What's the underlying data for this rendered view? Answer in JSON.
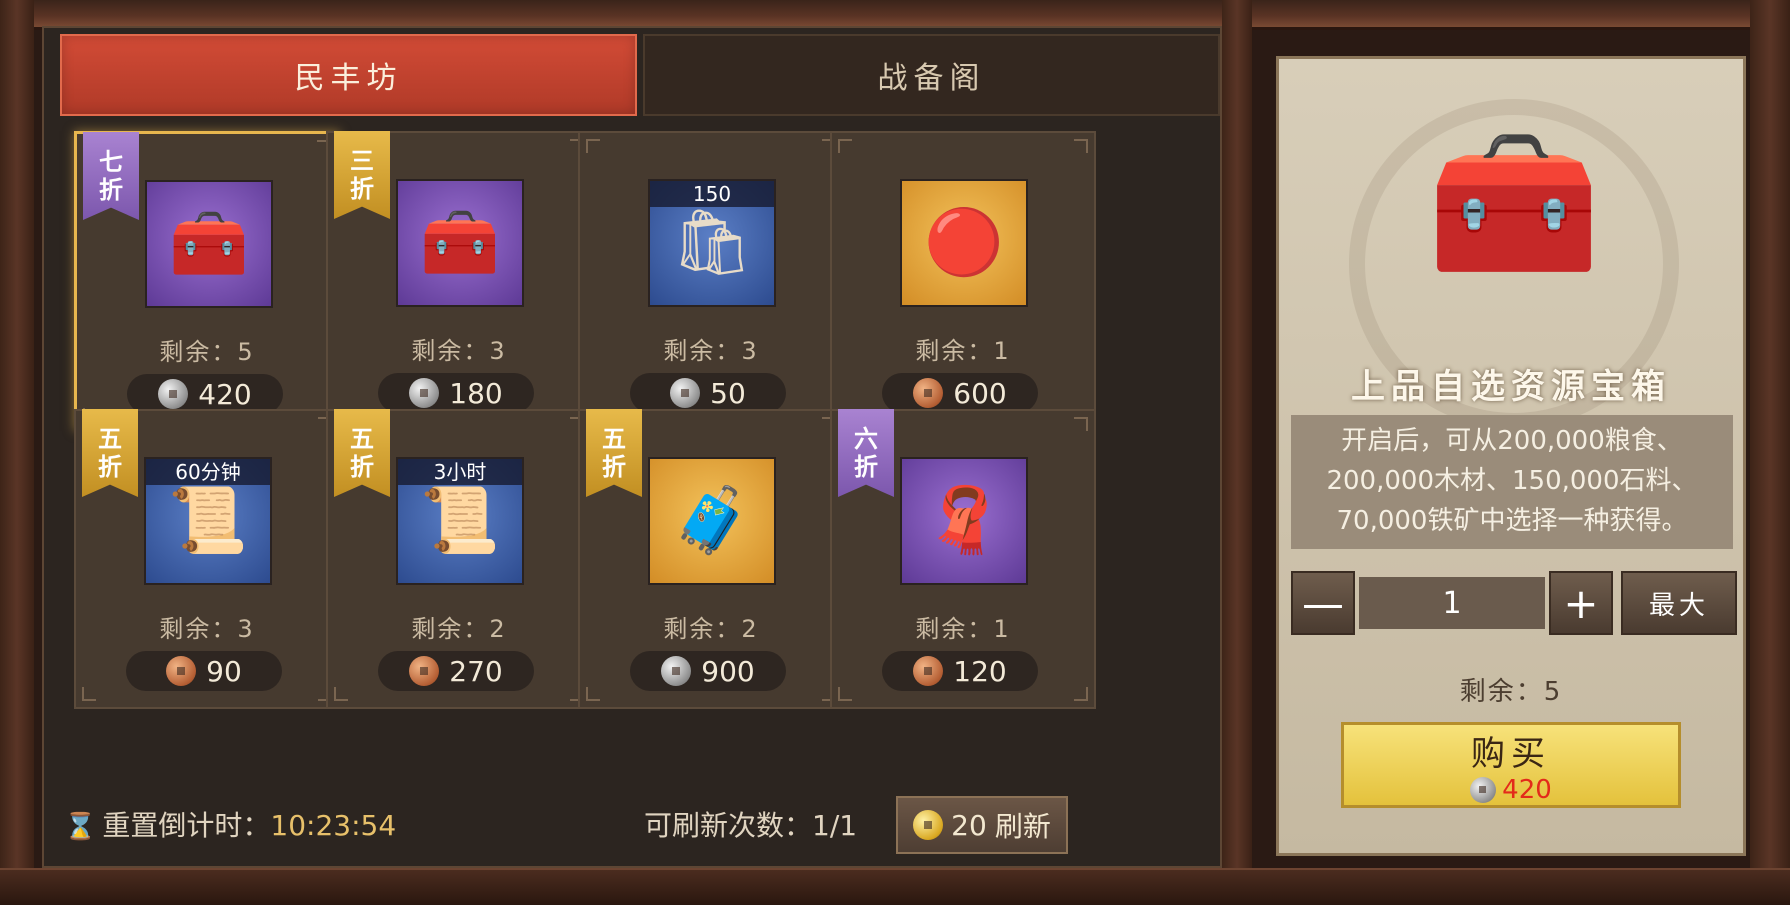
{
  "tabs": [
    {
      "label": "民丰坊",
      "active": true
    },
    {
      "label": "战备阁",
      "active": false
    }
  ],
  "items": [
    {
      "discount_line1": "七",
      "discount_line2": "折",
      "ribbon_color": "purple",
      "icon": "resource-chest-icon",
      "icon_bg": "purple",
      "tag": "",
      "remain": "剩余：5",
      "price": "420",
      "currency": "silver",
      "selected": true
    },
    {
      "discount_line1": "三",
      "discount_line2": "折",
      "ribbon_color": "gold",
      "icon": "resource-chest-icon",
      "icon_bg": "purple",
      "tag": "",
      "remain": "剩余：3",
      "price": "180",
      "currency": "silver",
      "selected": false
    },
    {
      "discount_line1": "",
      "discount_line2": "",
      "ribbon_color": "",
      "icon": "grain-sack-icon",
      "icon_bg": "blue",
      "tag": "150",
      "remain": "剩余：3",
      "price": "50",
      "currency": "silver",
      "selected": false
    },
    {
      "discount_line1": "",
      "discount_line2": "",
      "ribbon_color": "",
      "icon": "red-jade-icon",
      "icon_bg": "orange",
      "tag": "",
      "remain": "剩余：1",
      "price": "600",
      "currency": "copper",
      "selected": false
    },
    {
      "discount_line1": "五",
      "discount_line2": "折",
      "ribbon_color": "gold",
      "icon": "speedup-scroll-icon",
      "icon_bg": "blue",
      "tag": "60分钟",
      "remain": "剩余：3",
      "price": "90",
      "currency": "copper",
      "selected": false
    },
    {
      "discount_line1": "五",
      "discount_line2": "折",
      "ribbon_color": "gold",
      "icon": "speedup-scroll-icon",
      "icon_bg": "blue",
      "tag": "3小时",
      "remain": "剩余：2",
      "price": "270",
      "currency": "copper",
      "selected": false
    },
    {
      "discount_line1": "五",
      "discount_line2": "折",
      "ribbon_color": "gold",
      "icon": "wooden-chest-icon",
      "icon_bg": "orange",
      "tag": "",
      "remain": "剩余：2",
      "price": "900",
      "currency": "silver",
      "selected": false
    },
    {
      "discount_line1": "六",
      "discount_line2": "折",
      "ribbon_color": "purple",
      "icon": "purple-cloth-icon",
      "icon_bg": "purple",
      "tag": "",
      "remain": "剩余：1",
      "price": "120",
      "currency": "copper",
      "selected": false
    }
  ],
  "footer": {
    "reset_label": "重置倒计时：",
    "reset_time": "10:23:54",
    "refresh_count": "可刷新次数：1/1",
    "refresh_cost": "20",
    "refresh_label": "刷新"
  },
  "detail": {
    "title": "上品自选资源宝箱",
    "desc_line1": "开启后，可从200,000粮食、",
    "desc_line2": "200,000木材、150,000石料、",
    "desc_line3": "70,000铁矿中选择一种获得。",
    "minus_label": "—",
    "quantity": "1",
    "plus_label": "+",
    "max_label": "最大",
    "remain": "剩余：5",
    "buy_label": "购买",
    "buy_price": "420",
    "icon": "resource-chest-icon"
  },
  "colors": {
    "tab_active": "#c4412d",
    "price_red": "#e32a1a",
    "buy_yellow": "#f0d459",
    "selected_border": "#e7b64e"
  }
}
